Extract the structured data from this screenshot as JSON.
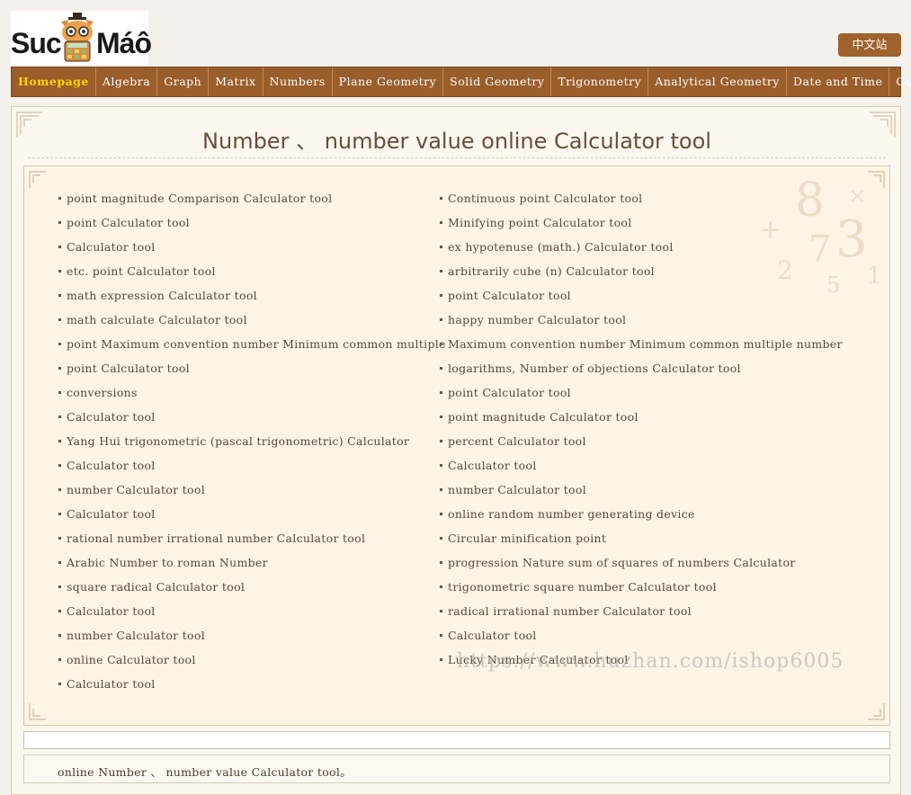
{
  "logo": {
    "left_text": "Suc",
    "right_text": "Máô",
    "icon": "cat-calculator-icon"
  },
  "header": {
    "language_button": "中文站"
  },
  "nav": {
    "items": [
      {
        "label": "Homepage",
        "active": true
      },
      {
        "label": "Algebra"
      },
      {
        "label": "Graph"
      },
      {
        "label": "Matrix"
      },
      {
        "label": "Numbers"
      },
      {
        "label": "Plane Geometry"
      },
      {
        "label": "Solid Geometry"
      },
      {
        "label": "Trigonometry"
      },
      {
        "label": "Analytical Geometry"
      },
      {
        "label": "Date and Time"
      },
      {
        "label": "Colors"
      }
    ]
  },
  "main": {
    "title": "Number 、 number value online Calculator tool",
    "left_links": [
      "point magnitude Comparison Calculator tool",
      "point Calculator tool",
      "Calculator tool",
      "etc. point Calculator tool",
      "math expression Calculator tool",
      "math calculate Calculator tool",
      "point Maximum convention number Minimum common multiple",
      "point Calculator tool",
      "conversions",
      "Calculator tool",
      "Yang Hui trigonometric (pascal trigonometric) Calculator",
      "Calculator tool",
      "number Calculator tool",
      "Calculator tool",
      "rational number irrational number Calculator tool",
      "Arabic Number to roman Number",
      "square radical Calculator tool",
      "Calculator tool",
      "number Calculator tool",
      "online Calculator tool",
      "Calculator tool"
    ],
    "right_links": [
      "Continuous point Calculator tool",
      "Minifying point Calculator tool",
      "ex hypotenuse (math.) Calculator tool",
      "arbitrarily cube (n) Calculator tool",
      "point Calculator tool",
      "happy number Calculator tool",
      "Maximum convention number Minimum common multiple number",
      "logarithms, Number of objections Calculator tool",
      "point Calculator tool",
      "point magnitude Calculator tool",
      "percent Calculator tool",
      "Calculator tool",
      "number Calculator tool",
      "online random number generating device",
      "Circular minification point",
      "progression Nature sum of squares of numbers Calculator",
      "trigonometric square number Calculator tool",
      "radical irrational number Calculator tool",
      "Calculator tool",
      "Lucky Number Calculator tool"
    ],
    "description": "online Number 、 number value Calculator tool。"
  },
  "watermark": "https://www.huzhan.com/ishop6005",
  "colors": {
    "nav_bg": "#9a5e2b",
    "accent": "#a0622c",
    "active_nav": "#ffd700"
  }
}
